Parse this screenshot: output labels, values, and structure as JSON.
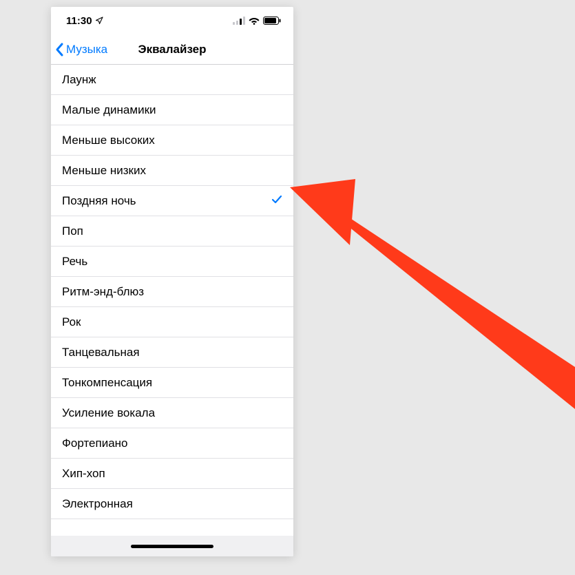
{
  "statusbar": {
    "time": "11:30"
  },
  "header": {
    "back_label": "Музыка",
    "title": "Эквалайзер"
  },
  "equalizer": {
    "selected_index": 4,
    "options": [
      {
        "label": "Лаунж"
      },
      {
        "label": "Малые динамики"
      },
      {
        "label": "Меньше высоких"
      },
      {
        "label": "Меньше низких"
      },
      {
        "label": "Поздняя ночь"
      },
      {
        "label": "Поп"
      },
      {
        "label": "Речь"
      },
      {
        "label": "Ритм-энд-блюз"
      },
      {
        "label": "Рок"
      },
      {
        "label": "Танцевальная"
      },
      {
        "label": "Тонкомпенсация"
      },
      {
        "label": "Усиление вокала"
      },
      {
        "label": "Фортепиано"
      },
      {
        "label": "Хип-хоп"
      },
      {
        "label": "Электронная"
      }
    ]
  },
  "colors": {
    "accent": "#007aff",
    "annotation": "#ff3a1a"
  }
}
